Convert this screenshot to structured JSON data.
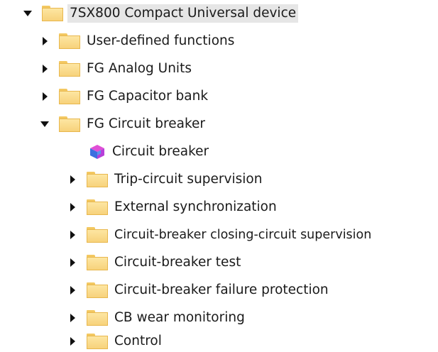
{
  "tree": {
    "root": {
      "label": "7SX800 Compact Universal device",
      "expanded": true,
      "icon": "folder-icon"
    },
    "level1": [
      {
        "label": "User-defined functions",
        "expanded": false,
        "icon": "folder-icon"
      },
      {
        "label": "FG Analog Units",
        "expanded": false,
        "icon": "folder-icon"
      },
      {
        "label": "FG Capacitor bank",
        "expanded": false,
        "icon": "folder-icon"
      },
      {
        "label": "FG Circuit breaker",
        "expanded": true,
        "icon": "folder-icon"
      }
    ],
    "circuit_breaker_children": [
      {
        "label": "Circuit breaker",
        "icon": "function-block-cube-icon"
      },
      {
        "label": "Trip-circuit supervision",
        "expanded": false,
        "icon": "folder-icon"
      },
      {
        "label": "External synchronization",
        "expanded": false,
        "icon": "folder-icon"
      },
      {
        "label": "Circuit-breaker closing-circuit supervision",
        "expanded": false,
        "icon": "folder-icon"
      },
      {
        "label": "Circuit-breaker test",
        "expanded": false,
        "icon": "folder-icon"
      },
      {
        "label": "Circuit-breaker failure protection",
        "expanded": false,
        "icon": "folder-icon"
      },
      {
        "label": "CB wear monitoring",
        "expanded": false,
        "icon": "folder-icon"
      },
      {
        "label": "Control",
        "expanded": false,
        "icon": "folder-icon"
      }
    ]
  },
  "colors": {
    "folder_fill": "#f7d27b",
    "folder_border": "#e8b74d",
    "selection": "#e6e6e6"
  }
}
